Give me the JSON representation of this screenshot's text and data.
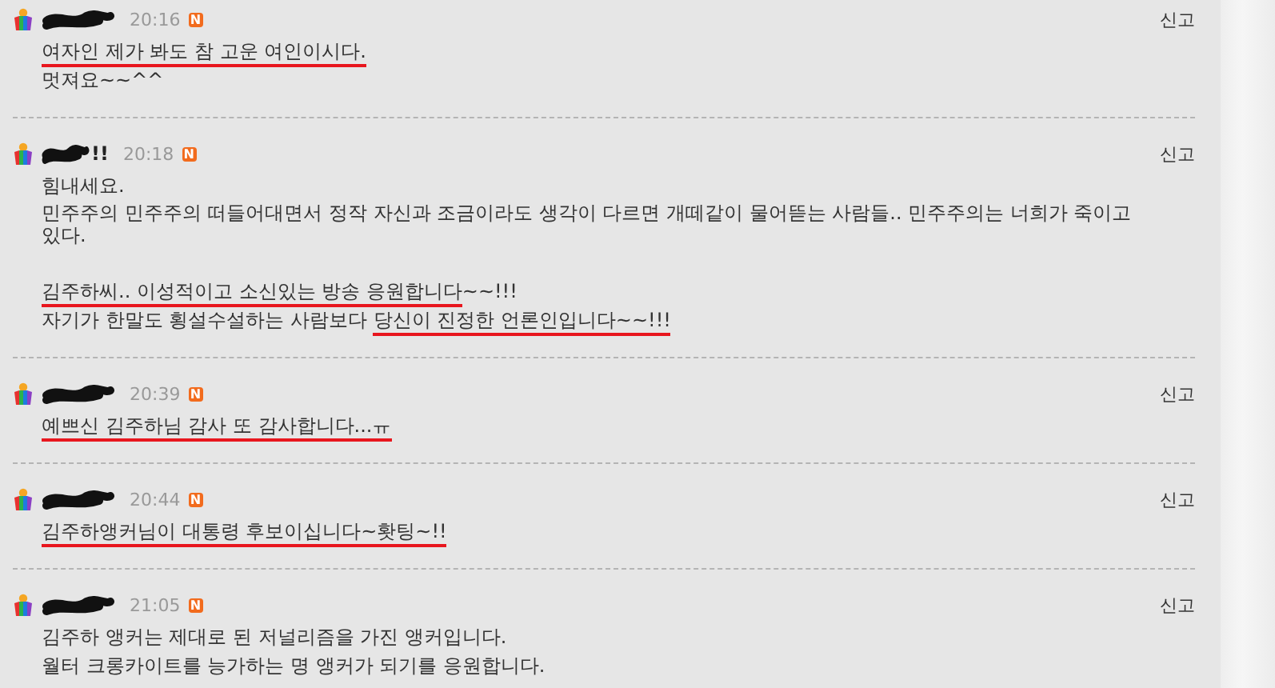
{
  "comments": [
    {
      "redacted": true,
      "time": "20:16",
      "badge": "N",
      "report": "신고",
      "lines": [
        {
          "segments": [
            {
              "text": "여자인 제가 봐도 참 고운 여인이시다.",
              "underlined": true
            }
          ]
        },
        {
          "segments": [
            {
              "text": "멋져요~~^^",
              "underlined": false
            }
          ]
        }
      ]
    },
    {
      "redacted": true,
      "author": "!!",
      "time": "20:18",
      "badge": "N",
      "report": "신고",
      "lines": [
        {
          "segments": [
            {
              "text": "힘내세요.",
              "underlined": false
            }
          ]
        },
        {
          "segments": [
            {
              "text": "민주주의 민주주의 떠들어대면서 정작 자신과 조금이라도 생각이 다르면 개떼같이 물어뜯는 사람들.. 민주주의는 너희가 죽이고 있다.",
              "underlined": false
            }
          ]
        },
        {
          "spaced": true,
          "segments": [
            {
              "text": "김주하씨.. 이성적이고 소신있는 방송 응원합니다",
              "underlined": true
            },
            {
              "text": "~~!!!",
              "underlined": false
            }
          ]
        },
        {
          "segments": [
            {
              "text": "자기가 한말도 횡설수설하는 사람보다 ",
              "underlined": false
            },
            {
              "text": "당신이 진정한 언론인입니다~~!!!",
              "underlined": true
            }
          ]
        }
      ]
    },
    {
      "redacted": true,
      "time": "20:39",
      "badge": "N",
      "report": "신고",
      "lines": [
        {
          "segments": [
            {
              "text": "예쁘신 김주하님 감사 또 감사합니다...ㅠ",
              "underlined": true
            }
          ]
        }
      ]
    },
    {
      "redacted": true,
      "time": "20:44",
      "badge": "N",
      "report": "신고",
      "lines": [
        {
          "segments": [
            {
              "text": "김주하앵커님이 대통령 후보이십니다~홧팅~!!",
              "underlined": true
            }
          ]
        }
      ]
    },
    {
      "redacted": true,
      "time": "21:05",
      "badge": "N",
      "report": "신고",
      "lines": [
        {
          "segments": [
            {
              "text": "김주하 앵커는 제대로 된 저널리즘을 가진 앵커입니다.",
              "underlined": false
            }
          ]
        },
        {
          "segments": [
            {
              "text": "월터 크롱카이트를 능가하는 명 앵커가 되기를 응원합니다.",
              "underlined": false
            }
          ]
        }
      ]
    }
  ]
}
